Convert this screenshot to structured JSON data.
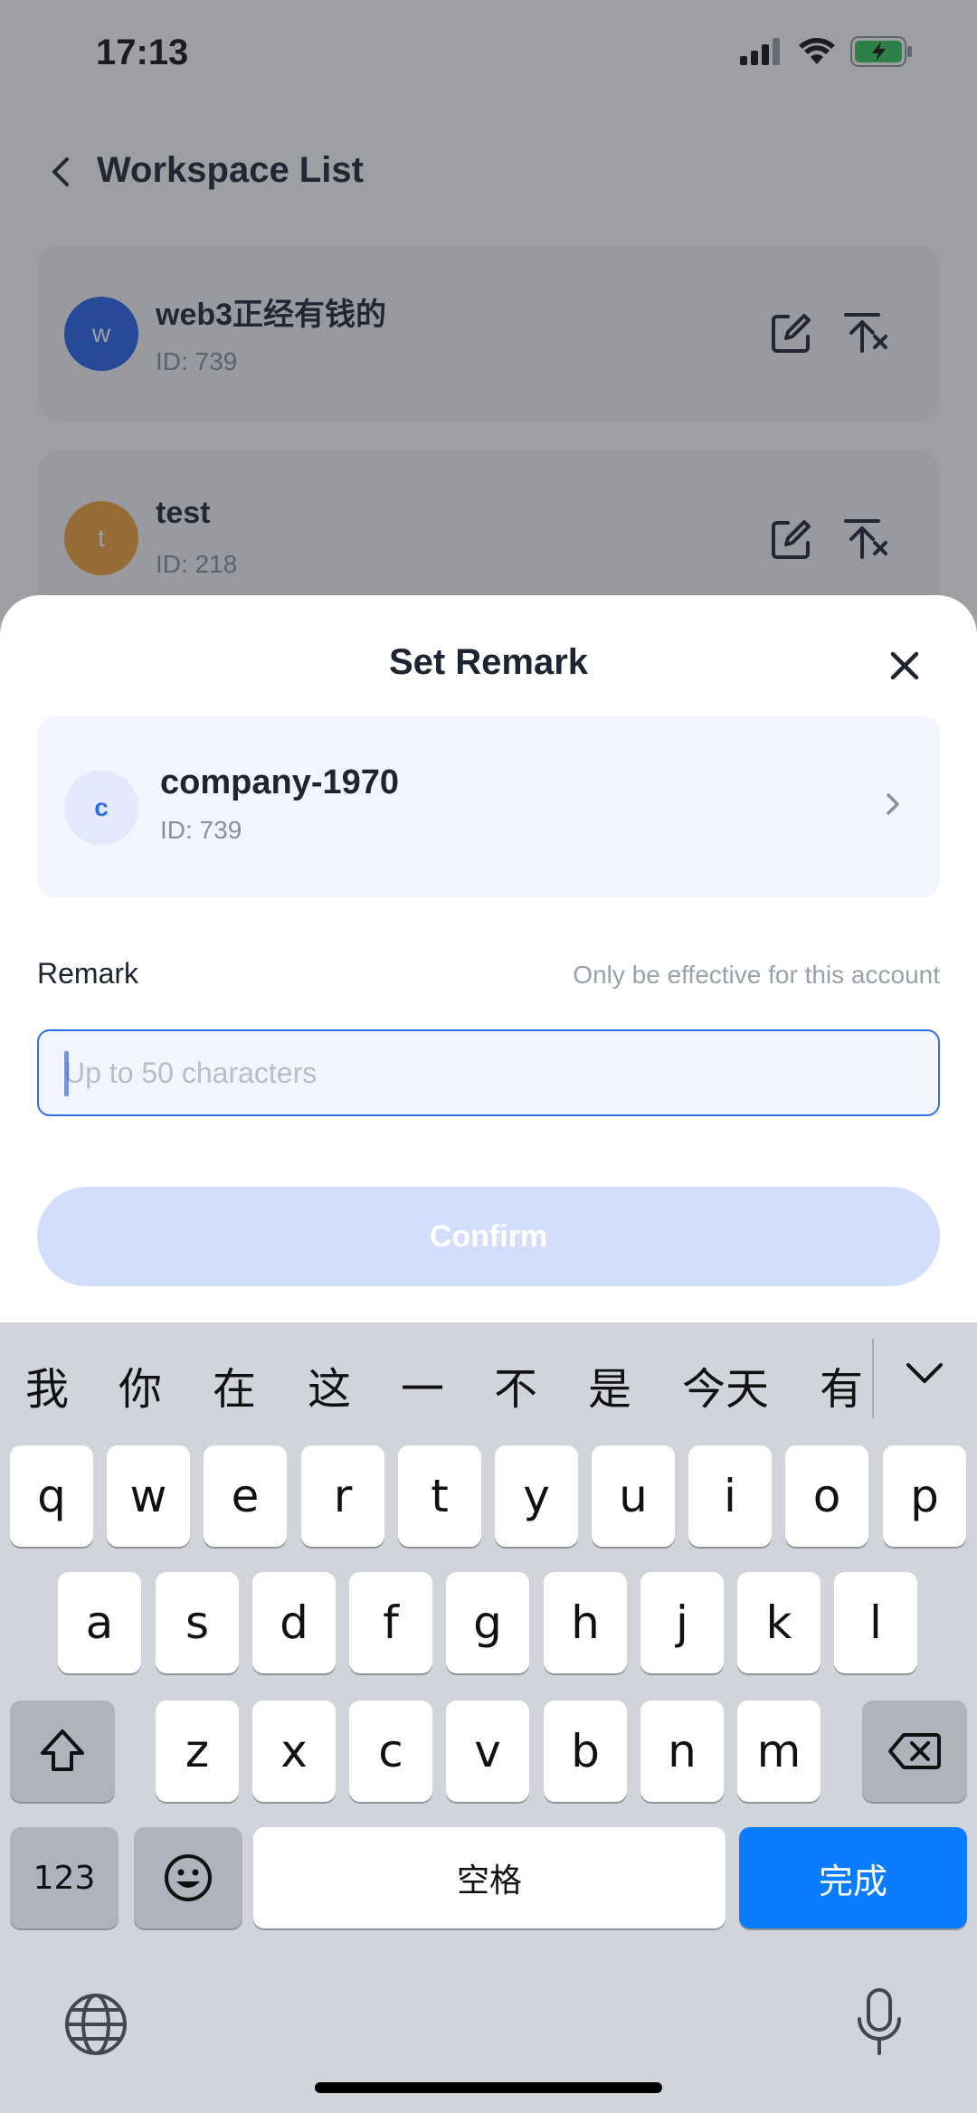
{
  "status_bar": {
    "time": "17:13"
  },
  "nav": {
    "title": "Workspace List"
  },
  "workspaces": [
    {
      "initial": "w",
      "name": "web3正经有钱的",
      "id": "ID: 739",
      "color": "#2563eb"
    },
    {
      "initial": "t",
      "name": "test",
      "id": "ID: 218",
      "color": "#f0a23a"
    }
  ],
  "sheet": {
    "title": "Set Remark",
    "company": {
      "initial": "c",
      "name": "company-1970",
      "id": "ID: 739"
    },
    "remark_label": "Remark",
    "remark_hint": "Only be effective for this account",
    "remark_placeholder": "Up to 50 characters",
    "remark_value": "",
    "confirm_label": "Confirm"
  },
  "keyboard": {
    "candidates": [
      "我",
      "你",
      "在",
      "这",
      "一",
      "不",
      "是",
      "今天",
      "有"
    ],
    "row1": [
      "q",
      "w",
      "e",
      "r",
      "t",
      "y",
      "u",
      "i",
      "o",
      "p"
    ],
    "row2": [
      "a",
      "s",
      "d",
      "f",
      "g",
      "h",
      "j",
      "k",
      "l"
    ],
    "row3": [
      "z",
      "x",
      "c",
      "v",
      "b",
      "n",
      "m"
    ],
    "numbers_label": "123",
    "space_label": "空格",
    "done_label": "完成"
  },
  "colors": {
    "accent": "#2f6fe4",
    "confirm_disabled": "#d3defd",
    "done_key": "#0a7cff"
  }
}
